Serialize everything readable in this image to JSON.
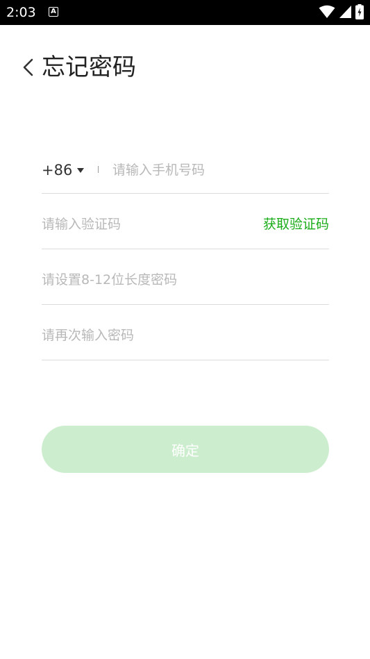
{
  "status_bar": {
    "time": "2:03",
    "notification_icon_letter": "A",
    "icons": [
      "wifi-icon",
      "cell-signal-icon",
      "battery-charging-icon"
    ]
  },
  "header": {
    "title": "忘记密码",
    "back_icon": "chevron-left-icon"
  },
  "form": {
    "country_code": "+86",
    "phone_placeholder": "请输入手机号码",
    "code_placeholder": "请输入验证码",
    "get_code_label": "获取验证码",
    "password_placeholder": "请设置8-12位长度密码",
    "confirm_password_placeholder": "请再次输入密码"
  },
  "confirm_button": {
    "label": "确定"
  },
  "colors": {
    "accent": "#1aad19",
    "button_disabled": "#cdeece",
    "placeholder": "#b8b8b8",
    "divider": "#dcdcdc"
  }
}
